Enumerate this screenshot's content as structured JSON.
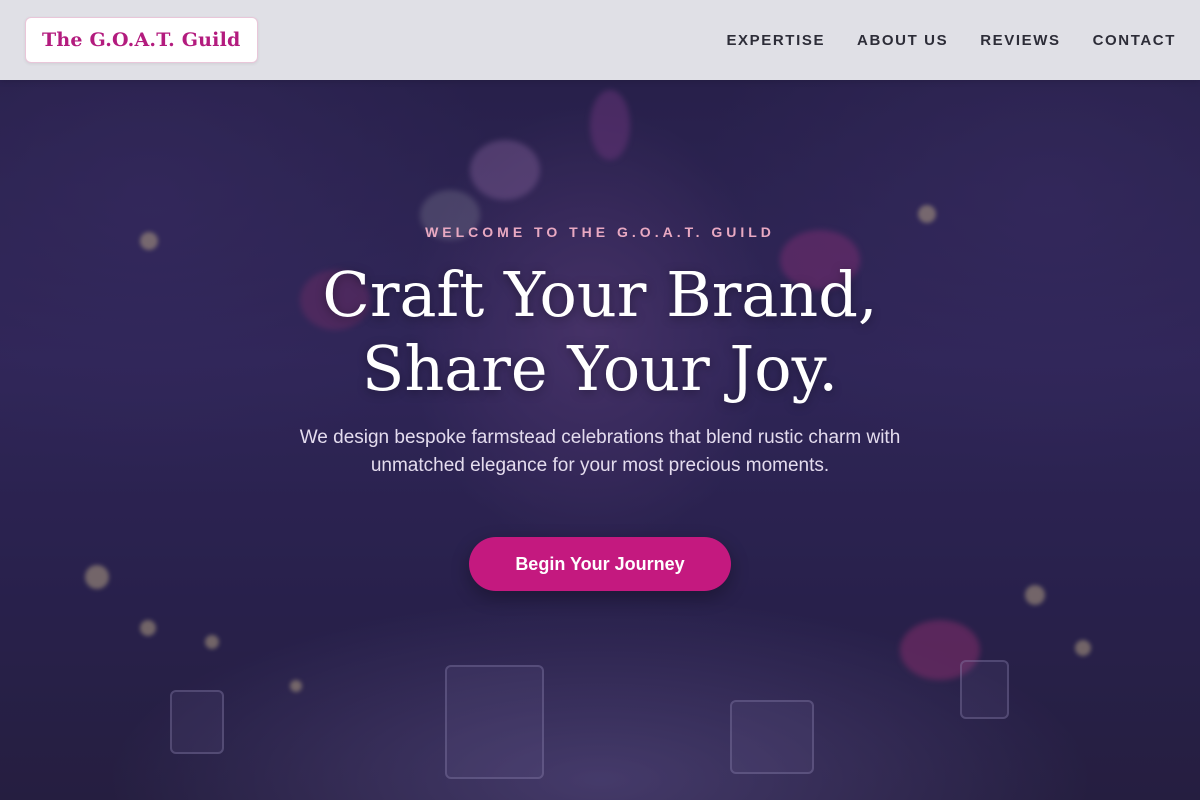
{
  "header": {
    "brand": "The G.O.A.T. Guild",
    "nav": [
      "EXPERTISE",
      "ABOUT US",
      "REVIEWS",
      "CONTACT"
    ]
  },
  "hero": {
    "eyebrow": "WELCOME TO THE G.O.A.T. GUILD",
    "headline_line1": "Craft Your Brand,",
    "headline_line2": "Share Your Joy.",
    "tagline": "We design bespoke farmstead celebrations that blend rustic charm with unmatched elegance for your most precious moments.",
    "cta": "Begin Your Journey"
  },
  "colors": {
    "brand_text": "#b31b7e",
    "accent_button": "#c4197f",
    "eyebrow": "#e9a9c2",
    "header_bg": "#e8e8ec"
  }
}
